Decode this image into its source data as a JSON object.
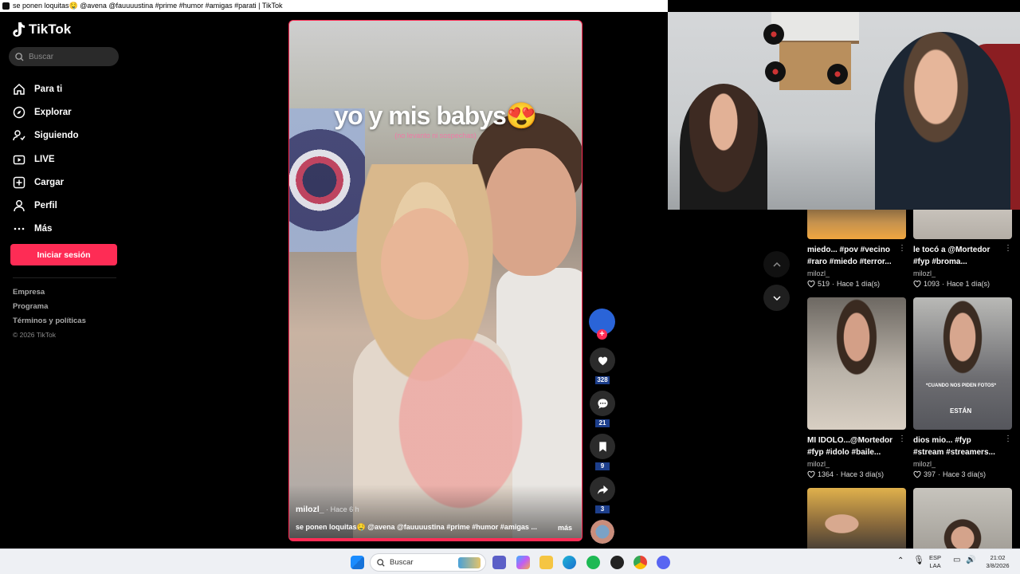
{
  "window": {
    "title": "se ponen loquitas🤤 @avena @fauuuustina #prime #humor #amigas #parati | TikTok"
  },
  "sidebar": {
    "logo": "TikTok",
    "search_placeholder": "Buscar",
    "items": [
      {
        "label": "Para ti",
        "icon": "home-icon"
      },
      {
        "label": "Explorar",
        "icon": "compass-icon"
      },
      {
        "label": "Siguiendo",
        "icon": "following-icon"
      },
      {
        "label": "LIVE",
        "icon": "live-icon"
      },
      {
        "label": "Cargar",
        "icon": "upload-icon"
      },
      {
        "label": "Perfil",
        "icon": "profile-icon"
      },
      {
        "label": "Más",
        "icon": "more-icon"
      }
    ],
    "login_label": "Iniciar sesión",
    "footer": [
      "Empresa",
      "Programa",
      "Términos y políticas"
    ],
    "copyright": "© 2026 TikTok"
  },
  "video": {
    "caption_big": "yo y mis babys😍",
    "caption_small": "(no levanto ni sospechas)",
    "author": "milozl_",
    "time": " · Hace 6 h",
    "description": "se ponen loquitas🤤 @avena @fauuuustina #prime #humor #amigas ...",
    "more": "más",
    "likes": "328",
    "comments": "21",
    "saves": "9",
    "shares": "3"
  },
  "grid": [
    {
      "title": "miedo... #pov #vecino #raro #miedo #terror...",
      "author": "milozl_",
      "likes": "519",
      "date": "Hace 1 día(s)"
    },
    {
      "title": "le tocó a @Mortedor #fyp #broma...",
      "author": "milozl_",
      "likes": "1093",
      "date": "Hace 1 día(s)"
    },
    {
      "title": "MI IDOLO...@Mortedor #fyp #idolo #baile...",
      "author": "milozl_",
      "likes": "1364",
      "date": "Hace 3 día(s)"
    },
    {
      "title": "dios mio... #fyp #stream #streamers...",
      "author": "milozl_",
      "likes": "397",
      "date": "Hace 3 día(s)"
    }
  ],
  "thumb_text": {
    "fotos": "*CUANDO NOS PIDEN FOTOS*",
    "estan": "ESTÁN"
  },
  "taskbar": {
    "search_label": "Buscar",
    "lang": "ESP",
    "lang2": "LAA",
    "time": "21:02",
    "date": "3/8/2026"
  }
}
